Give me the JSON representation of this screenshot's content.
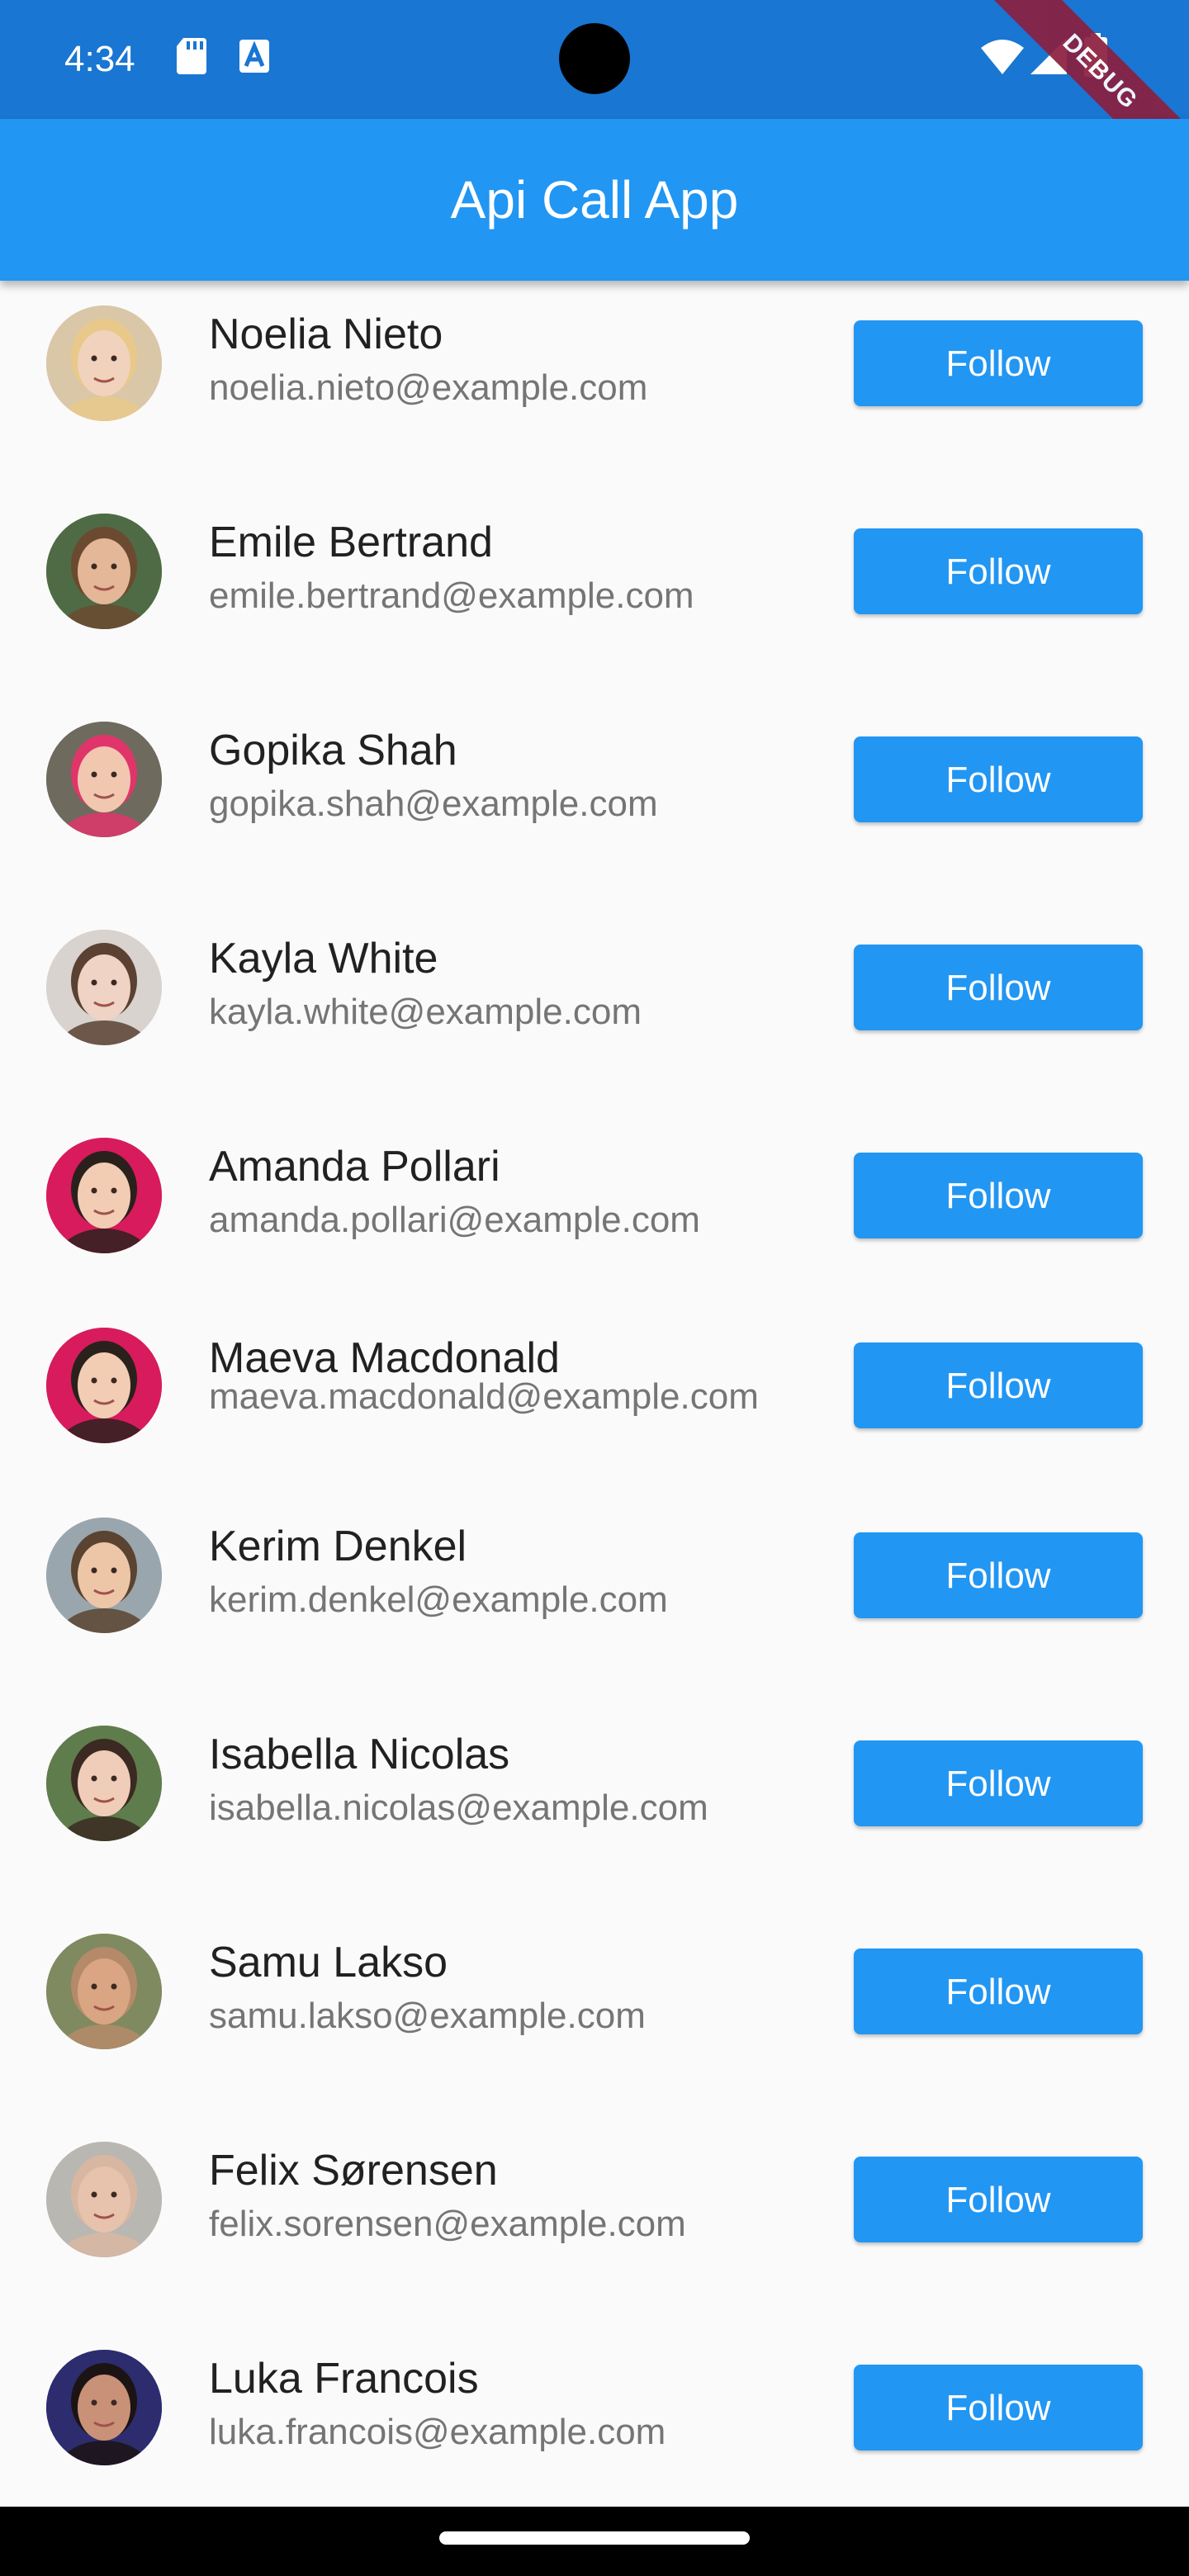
{
  "status_bar": {
    "time": "4:34",
    "left_icons": [
      "sd-card-icon",
      "keyboard-a-icon"
    ],
    "right_icons": [
      "wifi-icon",
      "cell-signal-icon",
      "battery-icon"
    ]
  },
  "debug_banner": "DEBUG",
  "app_bar": {
    "title": "Api Call App"
  },
  "users": [
    {
      "name": "Noelia Nieto",
      "email": "noelia.nieto@example.com",
      "button": "Follow",
      "avatar_bg": "#d9c7a8",
      "skin": "#f1d2bc",
      "hair": "#e8c98a"
    },
    {
      "name": "Emile Bertrand",
      "email": "emile.bertrand@example.com",
      "button": "Follow",
      "avatar_bg": "#4e6b45",
      "skin": "#e3b797",
      "hair": "#6b4a30"
    },
    {
      "name": "Gopika Shah",
      "email": "gopika.shah@example.com",
      "button": "Follow",
      "avatar_bg": "#6f6a5e",
      "skin": "#f1c7b0",
      "hair": "#e0356b"
    },
    {
      "name": "Kayla White",
      "email": "kayla.white@example.com",
      "button": "Follow",
      "avatar_bg": "#d8d3cf",
      "skin": "#efd3c4",
      "hair": "#5b4132"
    },
    {
      "name": "Amanda Pollari",
      "email": "amanda.pollari@example.com",
      "button": "Follow",
      "avatar_bg": "#d81b5c",
      "skin": "#f2cdb4",
      "hair": "#2b211c"
    },
    {
      "name": "Maeva Macdonald",
      "email": "maeva.macdonald@example.com",
      "button": "Follow",
      "avatar_bg": "#d81b5c",
      "skin": "#f2cdb4",
      "hair": "#2b211c"
    },
    {
      "name": "Kerim Denkel",
      "email": "kerim.denkel@example.com",
      "button": "Follow",
      "avatar_bg": "#9aa6ad",
      "skin": "#edc6a7",
      "hair": "#5a4330"
    },
    {
      "name": "Isabella Nicolas",
      "email": "isabella.nicolas@example.com",
      "button": "Follow",
      "avatar_bg": "#5f7c4d",
      "skin": "#f0cdb8",
      "hair": "#3a2a22"
    },
    {
      "name": "Samu Lakso",
      "email": "samu.lakso@example.com",
      "button": "Follow",
      "avatar_bg": "#7f8a60",
      "skin": "#d9a583",
      "hair": "#b58a6a"
    },
    {
      "name": "Felix Sørensen",
      "email": "felix.sorensen@example.com",
      "button": "Follow",
      "avatar_bg": "#b9b7b2",
      "skin": "#e7c2ad",
      "hair": "#d8b7a2"
    },
    {
      "name": "Luka Francois",
      "email": "luka.francois@example.com",
      "button": "Follow",
      "avatar_bg": "#2d2c6e",
      "skin": "#c99178",
      "hair": "#1c1414"
    }
  ],
  "colors": {
    "status_bar": "#1976d2",
    "app_bar": "#2196f3",
    "button": "#2196f3",
    "background": "#fafafa"
  }
}
